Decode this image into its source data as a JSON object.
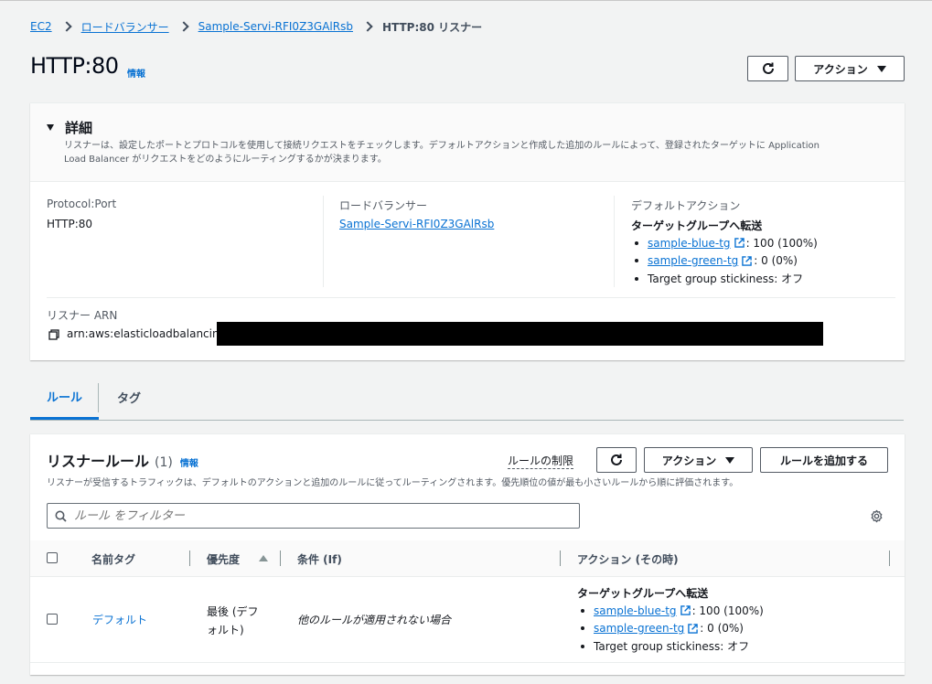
{
  "breadcrumb": {
    "items": [
      "EC2",
      "ロードバランサー",
      "Sample-Servi-RFI0Z3GAlRsb"
    ],
    "current": "HTTP:80 リスナー"
  },
  "page": {
    "title": "HTTP:80",
    "info": "情報",
    "actions_label": "アクション"
  },
  "details": {
    "title": "詳細",
    "description_line1": "リスナーは、設定したポートとプロトコルを使用して接続リクエストをチェックします。デフォルトアクションと作成した追加のルールによって、登録されたターゲットに Application",
    "description_line2": "Load Balancer がリクエストをどのようにルーティングするかが決まります。",
    "protocol_port_label": "Protocol:Port",
    "protocol_port_value": "HTTP:80",
    "lb_label": "ロードバランサー",
    "lb_value": "Sample-Servi-RFI0Z3GAlRsb",
    "default_action_label": "デフォルトアクション",
    "default_action_title": "ターゲットグループへ転送",
    "tg_blue": "sample-blue-tg",
    "tg_blue_weight": ": 100 (100%)",
    "tg_green": "sample-green-tg",
    "tg_green_weight": ": 0 (0%)",
    "stickiness": "Target group stickiness: オフ",
    "arn_label": "リスナー ARN",
    "arn_value": "arn:aws:elasticloadbalancing"
  },
  "tabs": [
    "ルール",
    "タグ"
  ],
  "rules": {
    "title": "リスナールール",
    "count": "(1)",
    "info": "情報",
    "limits_link": "ルールの制限",
    "actions_label": "アクション",
    "add_rule_label": "ルールを追加する",
    "description": "リスナーが受信するトラフィックは、デフォルトのアクションと追加のルールに従ってルーティングされます。優先順位の値が最も小さいルールから順に評価されます。",
    "filter_placeholder": "ルール をフィルター",
    "columns": [
      "名前タグ",
      "優先度",
      "条件 (If)",
      "アクション (その時)"
    ],
    "row": {
      "name": "デフォルト",
      "priority_line1": "最後 (デフ",
      "priority_line2": "ォルト)",
      "condition": "他のルールが適用されない場合",
      "action_title": "ターゲットグループへ転送",
      "tg_blue": "sample-blue-tg",
      "tg_blue_weight": ": 100 (100%)",
      "tg_green": "sample-green-tg",
      "tg_green_weight": ": 0 (0%)",
      "stickiness": "Target group stickiness: オフ"
    }
  },
  "colors": {
    "link": "#0972d3",
    "text": "#16191f",
    "background": "#f2f3f3"
  }
}
